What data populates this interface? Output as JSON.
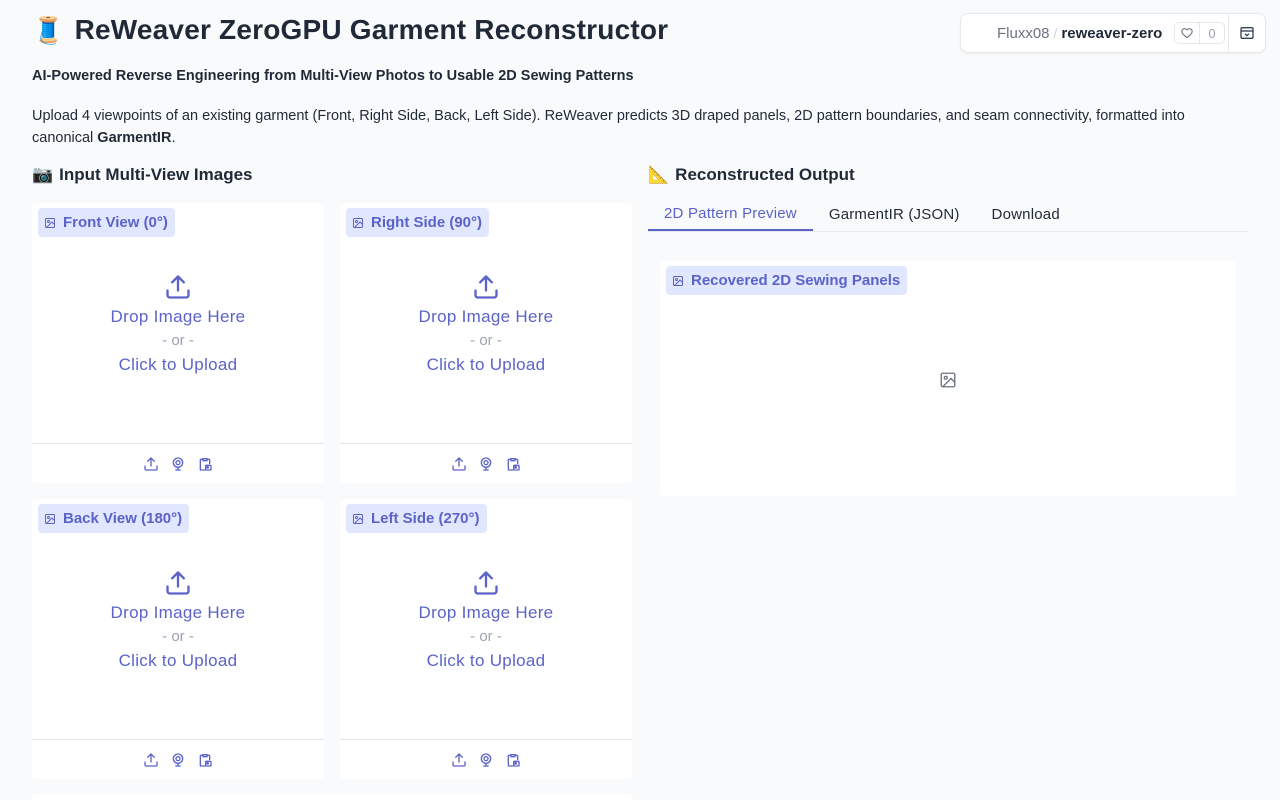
{
  "header": {
    "icon": "🧵",
    "title": "ReWeaver ZeroGPU Garment Reconstructor",
    "subtitle": "AI-Powered Reverse Engineering from Multi-View Photos to Usable 2D Sewing Patterns",
    "description": "Upload 4 viewpoints of an existing garment (Front, Right Side, Back, Left Side). ReWeaver predicts 3D draped panels, 2D pattern boundaries, and seam connectivity, formatted into canonical ",
    "description_bold": "GarmentIR",
    "description_end": "."
  },
  "hf_badge": {
    "owner": "Fluxx08",
    "separator": "/",
    "repo": "reweaver-zero",
    "likes": "0"
  },
  "inputs": {
    "icon": "📷",
    "heading": "Input Multi-View Images",
    "drop_text": "Drop Image Here",
    "or_text": "- or -",
    "click_text": "Click to Upload",
    "views": [
      {
        "label": "Front View (0°)"
      },
      {
        "label": "Right Side (90°)"
      },
      {
        "label": "Back View (180°)"
      },
      {
        "label": "Left Side (270°)"
      }
    ]
  },
  "output": {
    "icon": "📐",
    "heading": "Reconstructed Output",
    "tabs": [
      {
        "label": "2D Pattern Preview",
        "active": true
      },
      {
        "label": "GarmentIR (JSON)",
        "active": false
      },
      {
        "label": "Download",
        "active": false
      }
    ],
    "panel_label": "Recovered 2D Sewing Panels"
  },
  "colors": {
    "accent": "#5b63c9",
    "label_bg": "#e0e7ff",
    "background": "#f9fafb"
  }
}
